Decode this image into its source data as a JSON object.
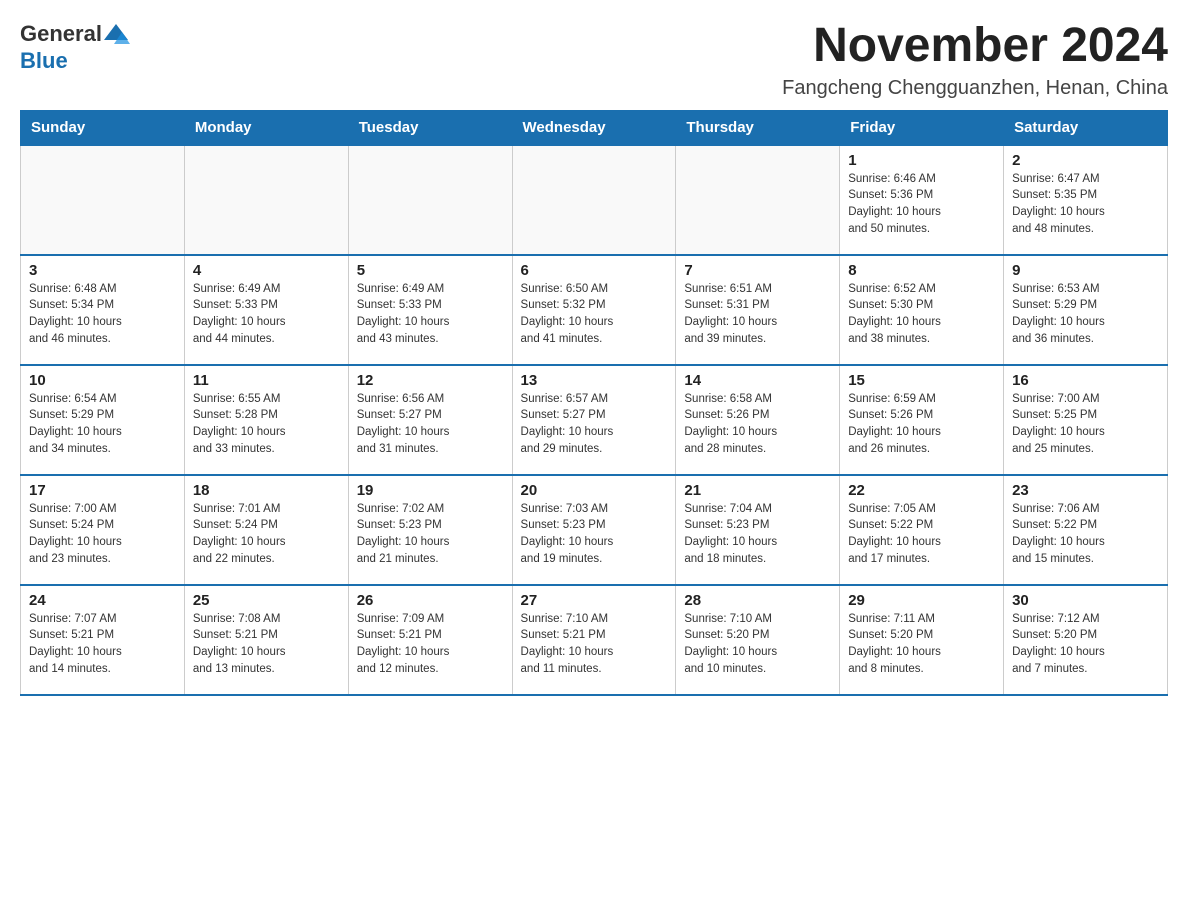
{
  "header": {
    "logo_general": "General",
    "logo_blue": "Blue",
    "month_title": "November 2024",
    "location": "Fangcheng Chengguanzhen, Henan, China"
  },
  "weekdays": [
    "Sunday",
    "Monday",
    "Tuesday",
    "Wednesday",
    "Thursday",
    "Friday",
    "Saturday"
  ],
  "weeks": [
    [
      {
        "day": "",
        "info": ""
      },
      {
        "day": "",
        "info": ""
      },
      {
        "day": "",
        "info": ""
      },
      {
        "day": "",
        "info": ""
      },
      {
        "day": "",
        "info": ""
      },
      {
        "day": "1",
        "info": "Sunrise: 6:46 AM\nSunset: 5:36 PM\nDaylight: 10 hours\nand 50 minutes."
      },
      {
        "day": "2",
        "info": "Sunrise: 6:47 AM\nSunset: 5:35 PM\nDaylight: 10 hours\nand 48 minutes."
      }
    ],
    [
      {
        "day": "3",
        "info": "Sunrise: 6:48 AM\nSunset: 5:34 PM\nDaylight: 10 hours\nand 46 minutes."
      },
      {
        "day": "4",
        "info": "Sunrise: 6:49 AM\nSunset: 5:33 PM\nDaylight: 10 hours\nand 44 minutes."
      },
      {
        "day": "5",
        "info": "Sunrise: 6:49 AM\nSunset: 5:33 PM\nDaylight: 10 hours\nand 43 minutes."
      },
      {
        "day": "6",
        "info": "Sunrise: 6:50 AM\nSunset: 5:32 PM\nDaylight: 10 hours\nand 41 minutes."
      },
      {
        "day": "7",
        "info": "Sunrise: 6:51 AM\nSunset: 5:31 PM\nDaylight: 10 hours\nand 39 minutes."
      },
      {
        "day": "8",
        "info": "Sunrise: 6:52 AM\nSunset: 5:30 PM\nDaylight: 10 hours\nand 38 minutes."
      },
      {
        "day": "9",
        "info": "Sunrise: 6:53 AM\nSunset: 5:29 PM\nDaylight: 10 hours\nand 36 minutes."
      }
    ],
    [
      {
        "day": "10",
        "info": "Sunrise: 6:54 AM\nSunset: 5:29 PM\nDaylight: 10 hours\nand 34 minutes."
      },
      {
        "day": "11",
        "info": "Sunrise: 6:55 AM\nSunset: 5:28 PM\nDaylight: 10 hours\nand 33 minutes."
      },
      {
        "day": "12",
        "info": "Sunrise: 6:56 AM\nSunset: 5:27 PM\nDaylight: 10 hours\nand 31 minutes."
      },
      {
        "day": "13",
        "info": "Sunrise: 6:57 AM\nSunset: 5:27 PM\nDaylight: 10 hours\nand 29 minutes."
      },
      {
        "day": "14",
        "info": "Sunrise: 6:58 AM\nSunset: 5:26 PM\nDaylight: 10 hours\nand 28 minutes."
      },
      {
        "day": "15",
        "info": "Sunrise: 6:59 AM\nSunset: 5:26 PM\nDaylight: 10 hours\nand 26 minutes."
      },
      {
        "day": "16",
        "info": "Sunrise: 7:00 AM\nSunset: 5:25 PM\nDaylight: 10 hours\nand 25 minutes."
      }
    ],
    [
      {
        "day": "17",
        "info": "Sunrise: 7:00 AM\nSunset: 5:24 PM\nDaylight: 10 hours\nand 23 minutes."
      },
      {
        "day": "18",
        "info": "Sunrise: 7:01 AM\nSunset: 5:24 PM\nDaylight: 10 hours\nand 22 minutes."
      },
      {
        "day": "19",
        "info": "Sunrise: 7:02 AM\nSunset: 5:23 PM\nDaylight: 10 hours\nand 21 minutes."
      },
      {
        "day": "20",
        "info": "Sunrise: 7:03 AM\nSunset: 5:23 PM\nDaylight: 10 hours\nand 19 minutes."
      },
      {
        "day": "21",
        "info": "Sunrise: 7:04 AM\nSunset: 5:23 PM\nDaylight: 10 hours\nand 18 minutes."
      },
      {
        "day": "22",
        "info": "Sunrise: 7:05 AM\nSunset: 5:22 PM\nDaylight: 10 hours\nand 17 minutes."
      },
      {
        "day": "23",
        "info": "Sunrise: 7:06 AM\nSunset: 5:22 PM\nDaylight: 10 hours\nand 15 minutes."
      }
    ],
    [
      {
        "day": "24",
        "info": "Sunrise: 7:07 AM\nSunset: 5:21 PM\nDaylight: 10 hours\nand 14 minutes."
      },
      {
        "day": "25",
        "info": "Sunrise: 7:08 AM\nSunset: 5:21 PM\nDaylight: 10 hours\nand 13 minutes."
      },
      {
        "day": "26",
        "info": "Sunrise: 7:09 AM\nSunset: 5:21 PM\nDaylight: 10 hours\nand 12 minutes."
      },
      {
        "day": "27",
        "info": "Sunrise: 7:10 AM\nSunset: 5:21 PM\nDaylight: 10 hours\nand 11 minutes."
      },
      {
        "day": "28",
        "info": "Sunrise: 7:10 AM\nSunset: 5:20 PM\nDaylight: 10 hours\nand 10 minutes."
      },
      {
        "day": "29",
        "info": "Sunrise: 7:11 AM\nSunset: 5:20 PM\nDaylight: 10 hours\nand 8 minutes."
      },
      {
        "day": "30",
        "info": "Sunrise: 7:12 AM\nSunset: 5:20 PM\nDaylight: 10 hours\nand 7 minutes."
      }
    ]
  ]
}
